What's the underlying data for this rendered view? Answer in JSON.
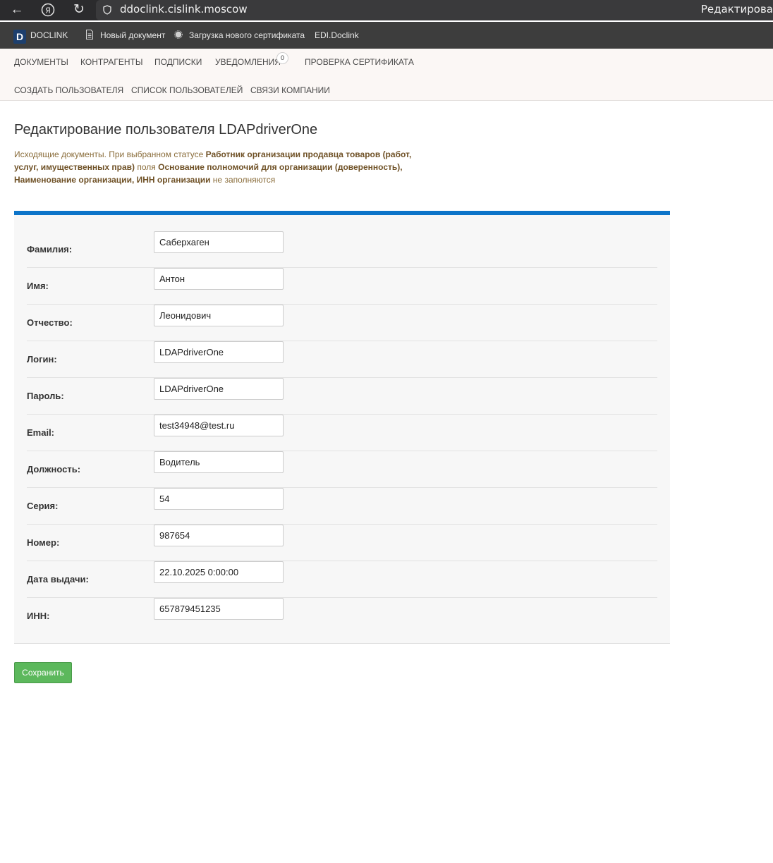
{
  "browser": {
    "url": "ddoclink.cislink.moscow",
    "tab_title_partial": "Редактирова",
    "yandex_glyph": "Я"
  },
  "appbar": {
    "logo_letter": "D",
    "logo_text": "DOCLINK",
    "new_document": "Новый документ",
    "upload_certificate": "Загрузка нового сертификата",
    "edi": "EDI.Doclink"
  },
  "nav": {
    "row1": [
      "ДОКУМЕНТЫ",
      "КОНТРАГЕНТЫ",
      "ПОДПИСКИ",
      "УВЕДОМЛЕНИЯ",
      "ПРОВЕРКА СЕРТИФИКАТА"
    ],
    "notifications_count": "0",
    "row2": [
      "СОЗДАТЬ ПОЛЬЗОВАТЕЛЯ",
      "СПИСОК ПОЛЬЗОВАТЕЛЕЙ",
      "СВЯЗИ КОМПАНИИ"
    ]
  },
  "page": {
    "title": "Редактирование пользователя LDAPdriverOne",
    "note": {
      "p1": "Исходящие документы. При выбранном статусе ",
      "b1": "Работник организации продавца товаров (работ, услуг, имущественных прав)",
      "p2": " поля ",
      "b2": "Основание полномочий для организации (доверенность), Наименование организации, ИНН организации",
      "p3": " не заполняются"
    }
  },
  "form": {
    "fields": [
      {
        "label": "Фамилия:",
        "value": "Саберхаген"
      },
      {
        "label": "Имя:",
        "value": "Антон"
      },
      {
        "label": "Отчество:",
        "value": "Леонидович"
      },
      {
        "label": "Логин:",
        "value": "LDAPdriverOne"
      },
      {
        "label": "Пароль:",
        "value": "LDAPdriverOne"
      },
      {
        "label": "Email:",
        "value": "test34948@test.ru"
      },
      {
        "label": "Должность:",
        "value": "Водитель"
      },
      {
        "label": "Серия:",
        "value": "54"
      },
      {
        "label": "Номер:",
        "value": "987654"
      },
      {
        "label": "Дата выдачи:",
        "value": "22.10.2025 0:00:00"
      },
      {
        "label": "ИНН:",
        "value": "657879451235"
      }
    ],
    "save_label": "Сохранить"
  },
  "colors": {
    "accent_blue": "#0d74c9",
    "save_green": "#5cb85c",
    "note_text": "#8a6d3b"
  }
}
